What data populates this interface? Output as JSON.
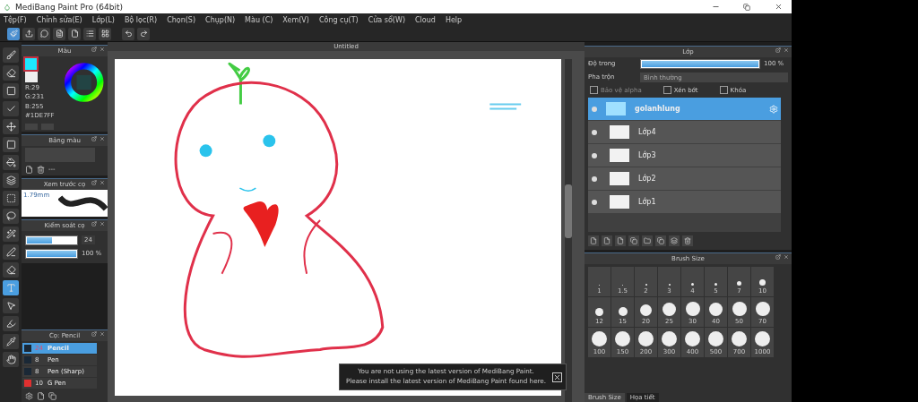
{
  "window": {
    "title": "MediBang Paint Pro (64bit)"
  },
  "menu": [
    "Tệp(F)",
    "Chỉnh sửa(E)",
    "Lớp(L)",
    "Bộ lọc(R)",
    "Chọn(S)",
    "Chụp(N)",
    "Màu (C)",
    "Xem(V)",
    "Công cụ(T)",
    "Cửa sổ(W)",
    "Cloud",
    "Help"
  ],
  "tools": [
    {
      "kind": "brush",
      "selected": false
    },
    {
      "kind": "eraser",
      "selected": false
    },
    {
      "kind": "rect",
      "selected": false
    },
    {
      "kind": "check",
      "selected": false
    },
    {
      "kind": "move",
      "selected": false
    },
    {
      "kind": "fill",
      "selected": false
    },
    {
      "kind": "bucket",
      "selected": false
    },
    {
      "kind": "gradient",
      "selected": false
    },
    {
      "kind": "select",
      "selected": false
    },
    {
      "kind": "lasso",
      "selected": false
    },
    {
      "kind": "wand",
      "selected": false
    },
    {
      "kind": "pen",
      "selected": false
    },
    {
      "kind": "erase-select",
      "selected": false
    },
    {
      "kind": "text",
      "selected": true
    },
    {
      "kind": "operation",
      "selected": false
    },
    {
      "kind": "dropper",
      "selected": false
    },
    {
      "kind": "eyedropper",
      "selected": false
    },
    {
      "kind": "hand",
      "selected": false
    }
  ],
  "color_panel": {
    "title": "Màu",
    "r": "R:29",
    "g": "G:231",
    "b": "B:255",
    "hex": "#1DE7FF",
    "color": "#1de7ff"
  },
  "palette_panel": {
    "title": "Bảng màu",
    "separator": "---"
  },
  "preview_panel": {
    "title": "Xem trước cọ",
    "size": "1.79mm"
  },
  "brush_control": {
    "title": "Kiểm soát cọ",
    "size": {
      "level": 0.5,
      "value": "24"
    },
    "opacity": {
      "level": 1,
      "value": "100 %"
    }
  },
  "canvas": {
    "tab": "Untitled"
  },
  "brush_panel": {
    "title": "Cọ: Pencil",
    "brushes": [
      {
        "size": "24",
        "name": "Pencil",
        "color": "#1a2836",
        "selected": true
      },
      {
        "size": "8",
        "name": "Pen",
        "color": "#1a2836",
        "selected": false
      },
      {
        "size": "8",
        "name": "Pen (Sharp)",
        "color": "#1a2836",
        "selected": false
      },
      {
        "size": "10",
        "name": "G Pen",
        "color": "#e03030",
        "selected": false
      }
    ]
  },
  "layer_panel": {
    "title": "Lớp",
    "opacity_label": "Độ trong",
    "opacity": {
      "level": 1,
      "value": "100 %"
    },
    "blend_label": "Pha trộn",
    "blend": "Bình thường",
    "options": [
      {
        "label": "Bảo vệ alpha",
        "checked": false,
        "disabled": true
      },
      {
        "label": "Xén bớt",
        "checked": false,
        "disabled": false
      },
      {
        "label": "Khóa",
        "checked": false,
        "disabled": false
      }
    ],
    "layers": [
      {
        "name": "golanhlung",
        "selected": true,
        "kind": "text"
      },
      {
        "name": "Lớp4",
        "selected": false,
        "kind": "raster"
      },
      {
        "name": "Lớp3",
        "selected": false,
        "kind": "raster"
      },
      {
        "name": "Lớp2",
        "selected": false,
        "kind": "raster"
      },
      {
        "name": "Lớp1",
        "selected": false,
        "kind": "raster"
      }
    ]
  },
  "brush_size_panel": {
    "title": "Brush Size",
    "sizes": [
      "1",
      "1.5",
      "2",
      "3",
      "4",
      "5",
      "7",
      "10",
      "12",
      "15",
      "20",
      "25",
      "30",
      "40",
      "50",
      "70",
      "100",
      "150",
      "200",
      "300",
      "400",
      "500",
      "700",
      "1000"
    ]
  },
  "bottom_tabs": [
    {
      "label": "Brush Size",
      "selected": true
    },
    {
      "label": "Họa tiết",
      "selected": false
    }
  ],
  "notification": {
    "lines": [
      "You are not using the latest version of MediBang Paint.",
      "Please install the latest version of MediBang Paint found here."
    ]
  }
}
